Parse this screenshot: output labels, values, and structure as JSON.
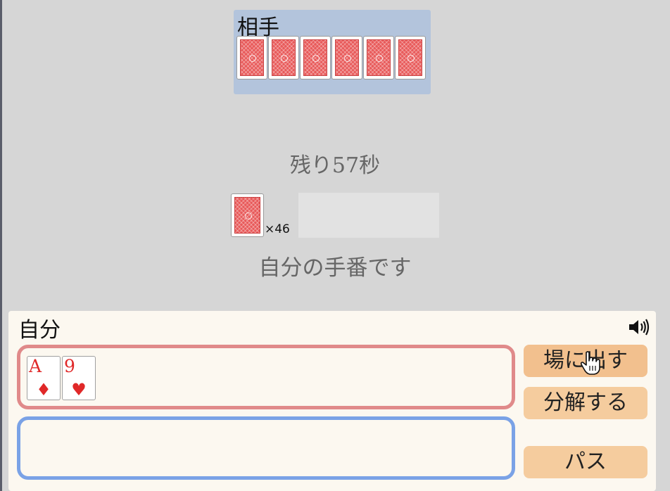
{
  "opponent": {
    "label": "相手",
    "card_count": 6
  },
  "timer": "残り57秒",
  "deck": {
    "count_label": "×46"
  },
  "turn_message": "自分の手番です",
  "player": {
    "label": "自分",
    "hand": [
      {
        "rank": "A",
        "suit": "♦",
        "color": "#e02828"
      },
      {
        "rank": "9",
        "suit": "♥",
        "color": "#e02828"
      }
    ]
  },
  "buttons": {
    "play": "場に出す",
    "split": "分解する",
    "pass": "パス"
  },
  "icons": {
    "sound": "speaker-icon",
    "cursor": "hand-pointer-icon"
  },
  "colors": {
    "card_back": "#e85a5a",
    "opponent_panel": "#b3c4dc",
    "hand_border": "#e08a8a",
    "select_border": "#7aa2e6",
    "button": "#f5cc9e"
  }
}
